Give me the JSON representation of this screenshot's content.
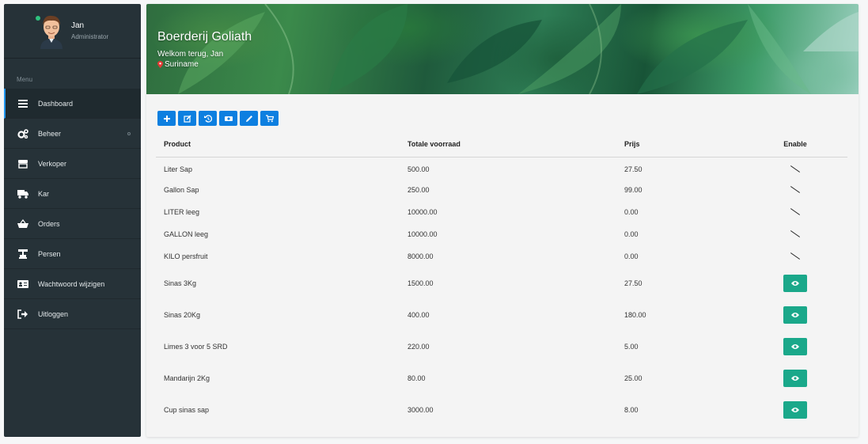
{
  "sidebar": {
    "user": {
      "name": "Jan",
      "role": "Administrator"
    },
    "menu_header": "Menu",
    "items": [
      {
        "label": "Dashboard",
        "icon": "bars-icon",
        "active": true
      },
      {
        "label": "Beheer",
        "icon": "cogs-icon",
        "has_submenu": true
      },
      {
        "label": "Verkoper",
        "icon": "store-icon"
      },
      {
        "label": "Kar",
        "icon": "truck-icon"
      },
      {
        "label": "Orders",
        "icon": "basket-icon"
      },
      {
        "label": "Persen",
        "icon": "press-icon"
      },
      {
        "label": "Wachtwoord wijzigen",
        "icon": "id-card-icon"
      },
      {
        "label": "Uitloggen",
        "icon": "sign-out-icon"
      }
    ]
  },
  "banner": {
    "title": "Boerderij Goliath",
    "welcome": "Welkom terug, Jan",
    "location": "Suriname"
  },
  "toolbar": {
    "buttons": [
      "plus-icon",
      "edit-icon",
      "history-icon",
      "money-icon",
      "pencil-icon",
      "cart-icon"
    ]
  },
  "table": {
    "headers": {
      "product": "Product",
      "stock": "Totale voorraad",
      "price": "Prijs",
      "enable": "Enable"
    },
    "rows": [
      {
        "product": "Liter Sap",
        "stock": "500.00",
        "price": "27.50",
        "enable": "slash"
      },
      {
        "product": "Gallon Sap",
        "stock": "250.00",
        "price": "99.00",
        "enable": "slash"
      },
      {
        "product": "LITER leeg",
        "stock": "10000.00",
        "price": "0.00",
        "enable": "slash"
      },
      {
        "product": "GALLON leeg",
        "stock": "10000.00",
        "price": "0.00",
        "enable": "slash"
      },
      {
        "product": "KILO persfruit",
        "stock": "8000.00",
        "price": "0.00",
        "enable": "slash"
      },
      {
        "product": "Sinas 3Kg",
        "stock": "1500.00",
        "price": "27.50",
        "enable": "eye"
      },
      {
        "product": "Sinas 20Kg",
        "stock": "400.00",
        "price": "180.00",
        "enable": "eye"
      },
      {
        "product": "Limes 3 voor 5 SRD",
        "stock": "220.00",
        "price": "5.00",
        "enable": "eye"
      },
      {
        "product": "Mandarijn 2Kg",
        "stock": "80.00",
        "price": "25.00",
        "enable": "eye"
      },
      {
        "product": "Cup sinas sap",
        "stock": "3000.00",
        "price": "8.00",
        "enable": "eye"
      }
    ]
  },
  "colors": {
    "sidebar_bg": "#263238",
    "primary": "#0d7fe0",
    "success": "#1aa88a",
    "online": "#2ec27e"
  }
}
